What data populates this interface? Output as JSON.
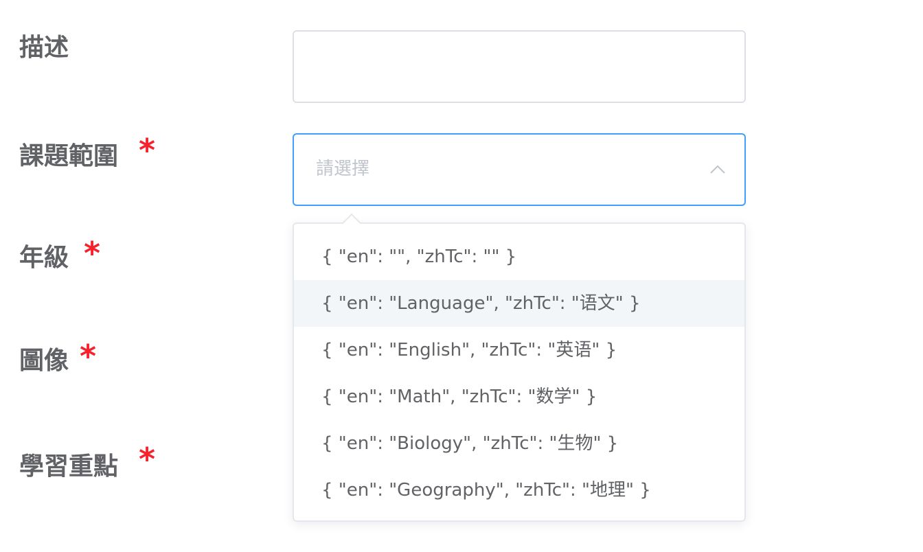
{
  "form": {
    "description_label": "描述",
    "subject_label": "課題範圍",
    "grade_label": "年級",
    "image_label": "圖像",
    "learning_points_label": "學習重點",
    "required_mark": "*",
    "description_value": "",
    "subject_placeholder": "請選擇"
  },
  "dropdown": {
    "options": [
      {
        "label": "{ \"en\": \"\", \"zhTc\": \"\" }"
      },
      {
        "label": "{ \"en\": \"Language\", \"zhTc\": \"语文\" }"
      },
      {
        "label": "{ \"en\": \"English\", \"zhTc\": \"英语\" }"
      },
      {
        "label": "{ \"en\": \"Math\", \"zhTc\": \"数学\" }"
      },
      {
        "label": "{ \"en\": \"Biology\", \"zhTc\": \"生物\" }"
      },
      {
        "label": "{ \"en\": \"Geography\", \"zhTc\": \"地理\" }"
      }
    ],
    "hovered_index": 1
  },
  "colors": {
    "focus_border": "#409eff",
    "required": "#f5222d",
    "hover_bg": "#f3f6f9"
  },
  "icons": {
    "select_chevron": "chevron-up-icon"
  }
}
